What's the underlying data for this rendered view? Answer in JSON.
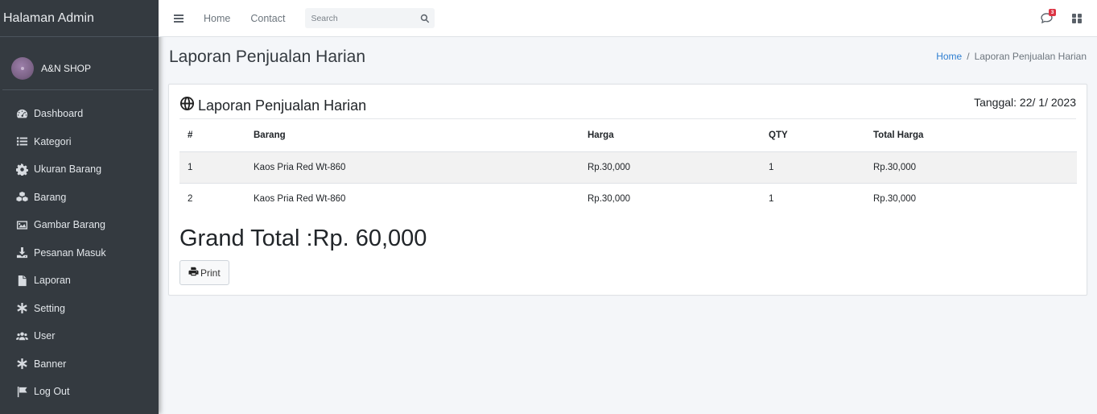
{
  "sidebar": {
    "brand": "Halaman Admin",
    "user_name": "A&N SHOP",
    "items": [
      {
        "label": "Dashboard",
        "icon": "tachometer-icon"
      },
      {
        "label": "Kategori",
        "icon": "list-icon"
      },
      {
        "label": "Ukuran Barang",
        "icon": "cog-icon"
      },
      {
        "label": "Barang",
        "icon": "cubes-icon"
      },
      {
        "label": "Gambar Barang",
        "icon": "image-icon"
      },
      {
        "label": "Pesanan Masuk",
        "icon": "download-icon"
      },
      {
        "label": "Laporan",
        "icon": "file-icon"
      },
      {
        "label": "Setting",
        "icon": "asterisk-icon"
      },
      {
        "label": "User",
        "icon": "users-icon"
      },
      {
        "label": "Banner",
        "icon": "asterisk-icon"
      },
      {
        "label": "Log Out",
        "icon": "flag-icon"
      }
    ]
  },
  "navbar": {
    "home": "Home",
    "contact": "Contact",
    "search_placeholder": "Search",
    "notification_count": "3"
  },
  "header": {
    "title": "Laporan Penjualan Harian",
    "breadcrumb_home": "Home",
    "breadcrumb_sep": "/",
    "breadcrumb_current": "Laporan Penjualan Harian"
  },
  "card": {
    "title": "Laporan Penjualan Harian",
    "date": "Tanggal: 22/ 1/ 2023",
    "columns": [
      "#",
      "Barang",
      "Harga",
      "QTY",
      "Total Harga"
    ],
    "rows": [
      {
        "no": "1",
        "barang": "Kaos Pria Red Wt-860",
        "harga": "Rp.30,000",
        "qty": "1",
        "total": "Rp.30,000"
      },
      {
        "no": "2",
        "barang": "Kaos Pria Red Wt-860",
        "harga": "Rp.30,000",
        "qty": "1",
        "total": "Rp.30,000"
      }
    ],
    "grand_total": "Grand Total :Rp. 60,000",
    "print_label": "Print"
  },
  "colors": {
    "sidebar_bg": "#343a40",
    "link_blue": "#2f7fd1",
    "badge_red": "#dc3545"
  }
}
